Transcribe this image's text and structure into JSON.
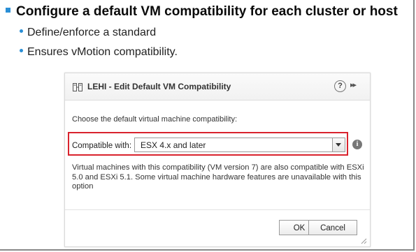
{
  "slide": {
    "heading": "Configure a default VM compatibility for each cluster or host",
    "bullets": [
      "Define/enforce a standard",
      "Ensures vMotion compatibility."
    ]
  },
  "dialog": {
    "title": "LEHI - Edit Default VM Compatibility",
    "help_label": "?",
    "expand_label": "▸▸",
    "prompt": "Choose the default virtual machine compatibility:",
    "compat_label": "Compatible with:",
    "compat_value": "ESX 4.x and later",
    "info_label": "i",
    "description": "Virtual machines with this compatibility (VM version 7) are also compatible with ESXi 5.0 and ESXi 5.1. Some virtual machine hardware features are unavailable with this option",
    "ok_label": "OK",
    "cancel_label": "Cancel"
  },
  "colors": {
    "bullet_accent": "#2a8fd6",
    "highlight_border": "#d9232d"
  },
  "icons": {
    "title": "cluster-icon",
    "info": "info-icon",
    "help": "help-icon"
  }
}
